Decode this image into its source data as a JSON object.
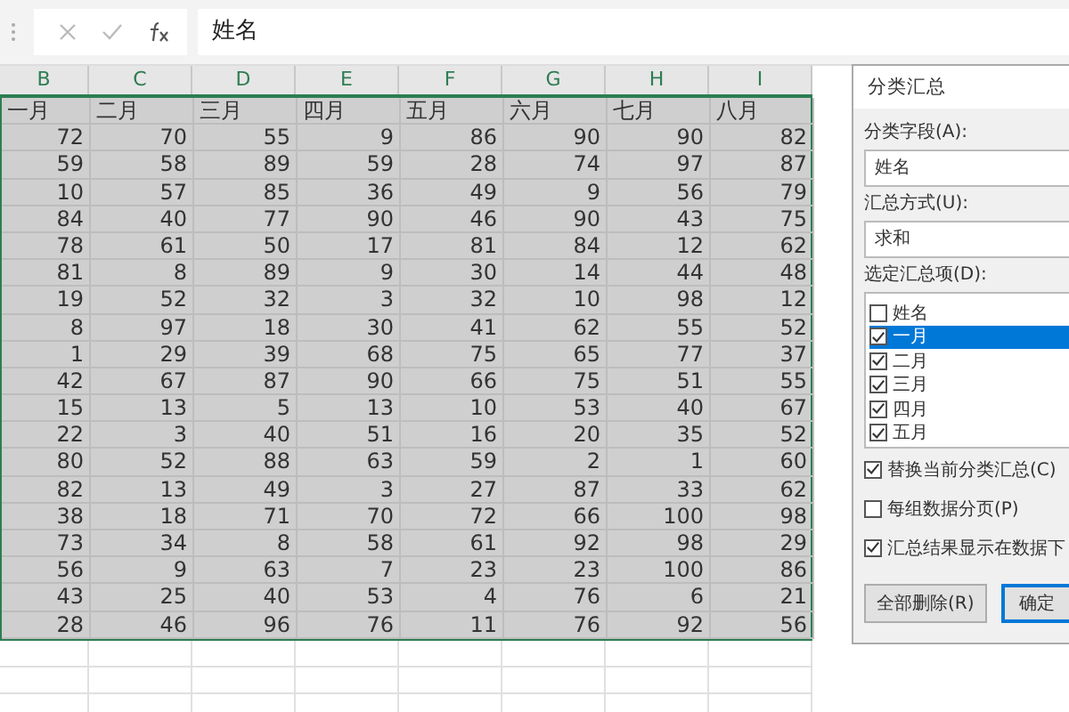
{
  "formula_bar": {
    "value": "姓名"
  },
  "columns": [
    "B",
    "C",
    "D",
    "E",
    "F",
    "G",
    "H",
    "I"
  ],
  "header_row": [
    "一月",
    "二月",
    "三月",
    "四月",
    "五月",
    "六月",
    "七月",
    "八月"
  ],
  "rows": [
    [
      "72",
      "70",
      "55",
      "9",
      "86",
      "90",
      "90",
      "82"
    ],
    [
      "59",
      "58",
      "89",
      "59",
      "28",
      "74",
      "97",
      "87"
    ],
    [
      "10",
      "57",
      "85",
      "36",
      "49",
      "9",
      "56",
      "79"
    ],
    [
      "84",
      "40",
      "77",
      "90",
      "46",
      "90",
      "43",
      "75"
    ],
    [
      "78",
      "61",
      "50",
      "17",
      "81",
      "84",
      "12",
      "62"
    ],
    [
      "81",
      "8",
      "89",
      "9",
      "30",
      "14",
      "44",
      "48"
    ],
    [
      "19",
      "52",
      "32",
      "3",
      "32",
      "10",
      "98",
      "12"
    ],
    [
      "8",
      "97",
      "18",
      "30",
      "41",
      "62",
      "55",
      "52"
    ],
    [
      "1",
      "29",
      "39",
      "68",
      "75",
      "65",
      "77",
      "37"
    ],
    [
      "42",
      "67",
      "87",
      "90",
      "66",
      "75",
      "51",
      "55"
    ],
    [
      "15",
      "13",
      "5",
      "13",
      "10",
      "53",
      "40",
      "67"
    ],
    [
      "22",
      "3",
      "40",
      "51",
      "16",
      "20",
      "35",
      "52"
    ],
    [
      "80",
      "52",
      "88",
      "63",
      "59",
      "2",
      "1",
      "60"
    ],
    [
      "82",
      "13",
      "49",
      "3",
      "27",
      "87",
      "33",
      "62"
    ],
    [
      "38",
      "18",
      "71",
      "70",
      "72",
      "66",
      "100",
      "98"
    ],
    [
      "73",
      "34",
      "8",
      "58",
      "61",
      "92",
      "98",
      "29"
    ],
    [
      "56",
      "9",
      "63",
      "7",
      "23",
      "23",
      "100",
      "86"
    ],
    [
      "43",
      "25",
      "40",
      "53",
      "4",
      "76",
      "6",
      "21"
    ],
    [
      "28",
      "46",
      "96",
      "76",
      "11",
      "76",
      "92",
      "56"
    ]
  ],
  "dialog": {
    "title": "分类汇总",
    "group_field": {
      "label": "分类字段(A):",
      "value": "姓名"
    },
    "method": {
      "label": "汇总方式(U):",
      "value": "求和"
    },
    "items_label": "选定汇总项(D):",
    "items": [
      {
        "label": "姓名",
        "checked": false,
        "selected": false
      },
      {
        "label": "一月",
        "checked": true,
        "selected": true
      },
      {
        "label": "二月",
        "checked": true,
        "selected": false
      },
      {
        "label": "三月",
        "checked": true,
        "selected": false
      },
      {
        "label": "四月",
        "checked": true,
        "selected": false
      },
      {
        "label": "五月",
        "checked": true,
        "selected": false
      }
    ],
    "options": [
      {
        "label": "替换当前分类汇总(C)",
        "checked": true
      },
      {
        "label": "每组数据分页(P)",
        "checked": false
      },
      {
        "label": "汇总结果显示在数据下",
        "checked": true
      }
    ],
    "buttons": [
      "全部删除(R)",
      "确定"
    ]
  }
}
